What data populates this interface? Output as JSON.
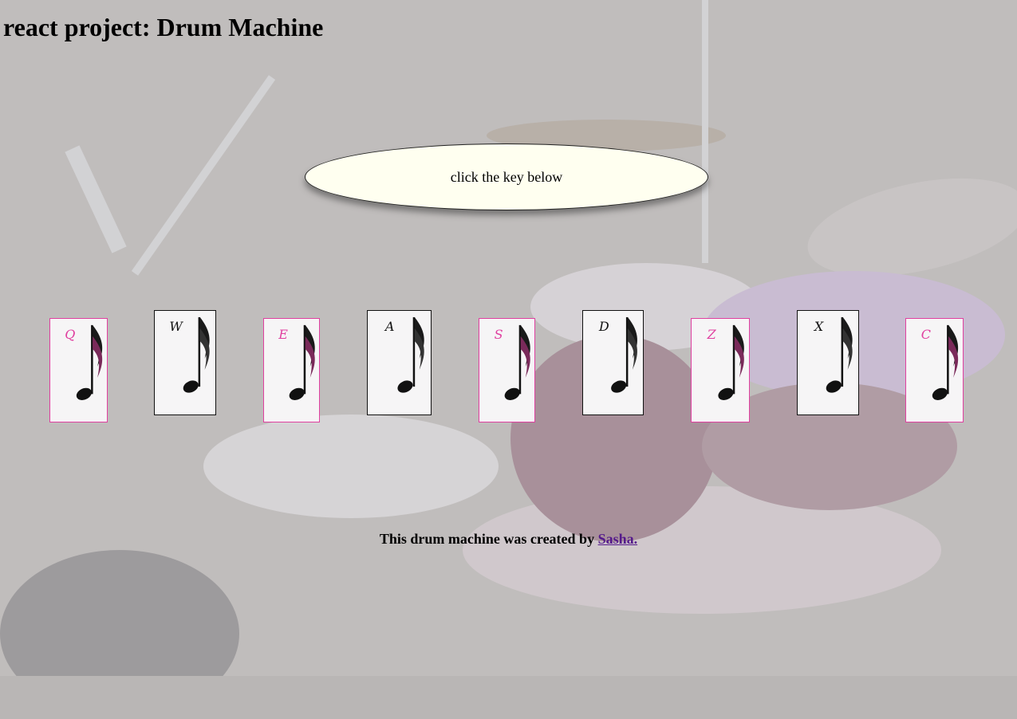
{
  "page": {
    "title": "react project: Drum Machine"
  },
  "display": {
    "text": "click the key below"
  },
  "pads": [
    {
      "key": "Q",
      "style": "pink"
    },
    {
      "key": "W",
      "style": "black"
    },
    {
      "key": "E",
      "style": "pink"
    },
    {
      "key": "A",
      "style": "black"
    },
    {
      "key": "S",
      "style": "pink"
    },
    {
      "key": "D",
      "style": "black"
    },
    {
      "key": "Z",
      "style": "pink"
    },
    {
      "key": "X",
      "style": "black"
    },
    {
      "key": "C",
      "style": "pink"
    }
  ],
  "footer": {
    "text": "This drum machine was created by ",
    "author_link": "Sasha."
  },
  "colors": {
    "pink_border": "#e040a0",
    "display_bg": "#fffff0",
    "link": "#551a8b"
  },
  "icons": {
    "pad_icon": "eighth-note-icon"
  }
}
